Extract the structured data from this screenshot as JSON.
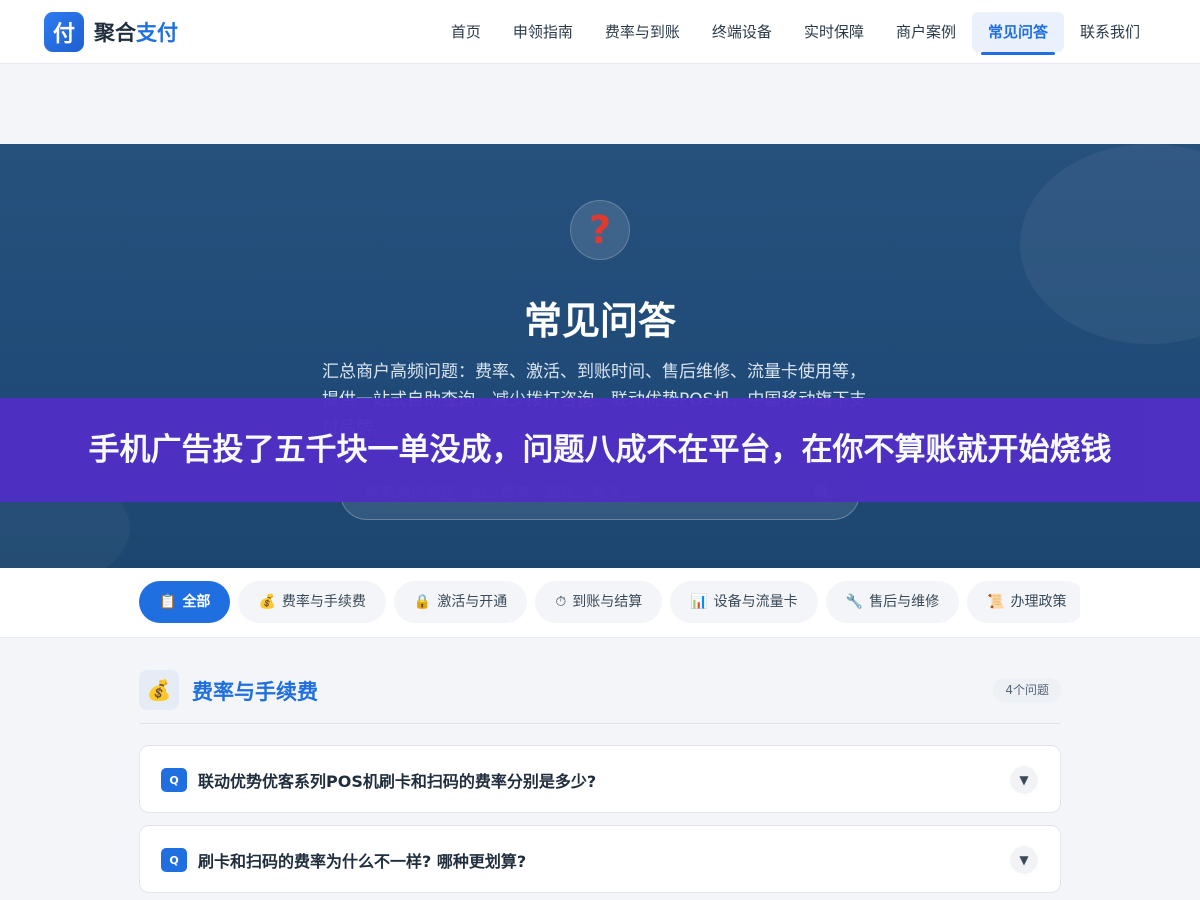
{
  "header": {
    "logo_char": "付",
    "brand_main": "聚合",
    "brand_accent": "支付",
    "nav": [
      {
        "label": "首页"
      },
      {
        "label": "申领指南"
      },
      {
        "label": "费率与到账"
      },
      {
        "label": "终端设备"
      },
      {
        "label": "实时保障"
      },
      {
        "label": "商户案例"
      },
      {
        "label": "常见问答",
        "active": true
      },
      {
        "label": "联系我们"
      }
    ]
  },
  "hero": {
    "icon": "?",
    "title": "常见问答",
    "description": "汇总商户高频问题：费率、激活、到账时间、售后维修、流量卡使用等，提供一站式自助查询，减少拨打咨询。联动优势POS机，中国移动旗下支付品牌。",
    "search_placeholder": "搜索常见问题，如：费率、到账、激活..."
  },
  "banner": {
    "text": "手机广告投了五千块一单没成，问题八成不在平台，在你不算账就开始烧钱"
  },
  "categories": [
    {
      "icon": "📋",
      "label": "全部",
      "active": true
    },
    {
      "icon": "💰",
      "label": "费率与手续费"
    },
    {
      "icon": "🔒",
      "label": "激活与开通"
    },
    {
      "icon": "⏱",
      "label": "到账与结算"
    },
    {
      "icon": "📊",
      "label": "设备与流量卡"
    },
    {
      "icon": "🔧",
      "label": "售后与维修"
    },
    {
      "icon": "📜",
      "label": "办理政策"
    }
  ],
  "section": {
    "icon": "💰",
    "title": "费率与手续费",
    "count": "4个问题"
  },
  "faqs": [
    {
      "badge": "Q",
      "question": "联动优势优客系列POS机刷卡和扫码的费率分别是多少?"
    },
    {
      "badge": "Q",
      "question": "刷卡和扫码的费率为什么不一样? 哪种更划算?"
    }
  ],
  "colors": {
    "primary": "#1f6fe0",
    "hero_bg": "#1f4a77",
    "banner_bg": "#4f2fc4"
  }
}
